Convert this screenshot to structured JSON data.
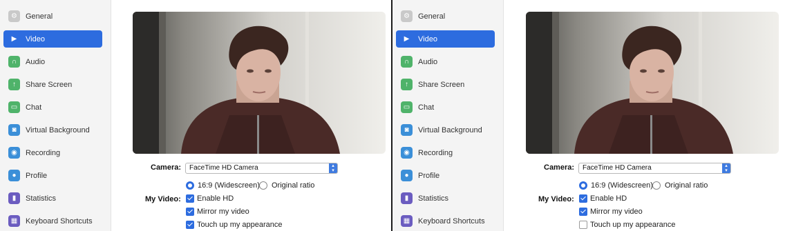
{
  "sidebar": {
    "items": [
      {
        "label": "General",
        "icon": "gear-icon",
        "color": "#c9c9c9"
      },
      {
        "label": "Video",
        "icon": "video-camera-icon",
        "color": "#ffffff"
      },
      {
        "label": "Audio",
        "icon": "headphones-icon",
        "color": "#4fb36a"
      },
      {
        "label": "Share Screen",
        "icon": "share-screen-icon",
        "color": "#4fb36a"
      },
      {
        "label": "Chat",
        "icon": "chat-icon",
        "color": "#4fb36a"
      },
      {
        "label": "Virtual Background",
        "icon": "virtual-background-icon",
        "color": "#3b8fd8"
      },
      {
        "label": "Recording",
        "icon": "recording-icon",
        "color": "#3b8fd8"
      },
      {
        "label": "Profile",
        "icon": "profile-icon",
        "color": "#3b8fd8"
      },
      {
        "label": "Statistics",
        "icon": "statistics-icon",
        "color": "#6b5cc0"
      },
      {
        "label": "Keyboard Shortcuts",
        "icon": "keyboard-icon",
        "color": "#6b5cc0"
      }
    ],
    "active_index": 1,
    "accent": "#2d6cdf"
  },
  "settings": {
    "camera_label": "Camera:",
    "camera_value": "FaceTime HD Camera",
    "ratio_widescreen": "16:9 (Widescreen)",
    "ratio_original": "Original ratio",
    "my_video_label": "My Video:",
    "enable_hd": "Enable HD",
    "mirror": "Mirror my video",
    "touch_up": "Touch up my appearance"
  },
  "panels": [
    {
      "enable_hd": true,
      "mirror": true,
      "touch_up": true,
      "widescreen": true
    },
    {
      "enable_hd": true,
      "mirror": true,
      "touch_up": false,
      "widescreen": true
    }
  ]
}
